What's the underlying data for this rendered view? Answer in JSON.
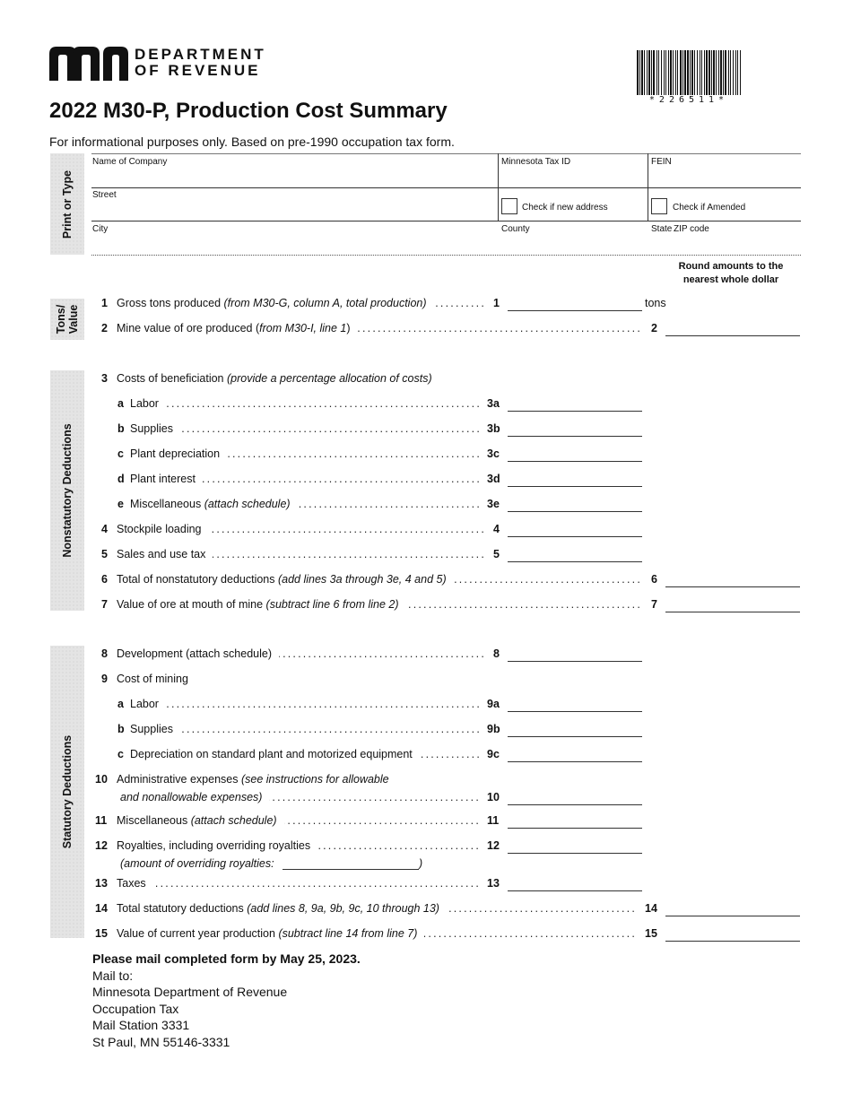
{
  "header": {
    "department_line1": "DEPARTMENT",
    "department_line2": "OF REVENUE",
    "barcode_text": "*226511*",
    "title": "2022 M30-P, Production Cost Summary",
    "subtitle": "For informational purposes only. Based on pre-1990 occupation tax form."
  },
  "sections": {
    "print_or_type": "Print or Type",
    "tons_value": "Tons/ Value",
    "nonstatutory": "Nonstatutory Deductions",
    "statutory": "Statutory Deductions"
  },
  "identification": {
    "company_label": "Name of Company",
    "tax_id_label": "Minnesota Tax ID",
    "fein_label": "FEIN",
    "street_label": "Street",
    "new_address_label": "Check if new address",
    "amended_label": "Check if Amended",
    "city_label": "City",
    "county_label": "County",
    "state_label": "State",
    "zip_label": "ZIP code",
    "company_value": "",
    "tax_id_value": "",
    "fein_value": "",
    "street_value": "",
    "city_value": "",
    "county_value": "",
    "state_value": "",
    "zip_value": "",
    "new_address_checked": false,
    "amended_checked": false
  },
  "round_note": "Round amounts to the nearest whole dollar",
  "lines": [
    {
      "num": "1",
      "label": "Gross tons produced ",
      "note": "(from M30-G, column A, total production)",
      "ref": "1",
      "unit": "tons",
      "value": ""
    },
    {
      "num": "2",
      "label": "Mine value of ore produced (",
      "note": "from M30-I, line 1",
      "suffix": ")",
      "ref": "2",
      "value": ""
    },
    {
      "num": "3",
      "label": "Costs of beneficiation ",
      "note": "(provide a percentage allocation of costs)"
    },
    {
      "num": "a",
      "label": "Labor",
      "ref": "3a",
      "value": ""
    },
    {
      "num": "b",
      "label": "Supplies",
      "ref": "3b",
      "value": ""
    },
    {
      "num": "c",
      "label": "Plant depreciation",
      "ref": "3c",
      "value": ""
    },
    {
      "num": "d",
      "label": "Plant interest",
      "ref": "3d",
      "value": ""
    },
    {
      "num": "e",
      "label": "Miscellaneous ",
      "note": "(attach schedule)",
      "ref": "3e",
      "value": ""
    },
    {
      "num": "4",
      "label": "Stockpile loading",
      "ref": "4",
      "value": ""
    },
    {
      "num": "5",
      "label": "Sales and use tax",
      "ref": "5",
      "value": ""
    },
    {
      "num": "6",
      "label": "Total of nonstatutory deductions ",
      "note": "(add lines 3a through 3e, 4 and 5)",
      "ref": "6",
      "value": ""
    },
    {
      "num": "7",
      "label": "Value of ore at mouth of mine ",
      "note": "(subtract line 6 from line 2)",
      "ref": "7",
      "value": ""
    },
    {
      "num": "8",
      "label": "Development (attach schedule)",
      "ref": "8",
      "value": ""
    },
    {
      "num": "9",
      "label": "Cost of mining"
    },
    {
      "num": "a",
      "label": "Labor",
      "ref": "9a",
      "value": ""
    },
    {
      "num": "b",
      "label": "Supplies",
      "ref": "9b",
      "value": ""
    },
    {
      "num": "c",
      "label": "Depreciation on standard plant and motorized equipment",
      "ref": "9c",
      "value": ""
    },
    {
      "num": "10",
      "label": "Administrative expenses ",
      "note": "(see instructions for allowable",
      "note2": "and nonallowable expenses)",
      "ref": "10",
      "value": ""
    },
    {
      "num": "11",
      "label": "Miscellaneous ",
      "note": "(attach schedule)",
      "ref": "11",
      "value": ""
    },
    {
      "num": "12",
      "label": "Royalties, including overriding royalties",
      "note2": "(amount of overriding royalties:",
      "note2_suffix": ")",
      "ref": "12",
      "value": "",
      "overriding_value": ""
    },
    {
      "num": "13",
      "label": "Taxes",
      "ref": "13",
      "value": ""
    },
    {
      "num": "14",
      "label": "Total statutory deductions ",
      "note": "(add lines 8, 9a, 9b, 9c, 10 through 13)",
      "ref": "14",
      "value": ""
    },
    {
      "num": "15",
      "label": "Value of current year production ",
      "note": "(subtract line 14 from line 7)",
      "ref": "15",
      "value": ""
    }
  ],
  "mail": {
    "deadline": "Please mail completed form by May 25, 2023.",
    "mail_to": "Mail to:",
    "address_line1": "Minnesota Department of Revenue",
    "address_line2": "Occupation Tax",
    "address_line3": "Mail Station 3331",
    "address_line4": "St Paul, MN 55146-3331"
  }
}
